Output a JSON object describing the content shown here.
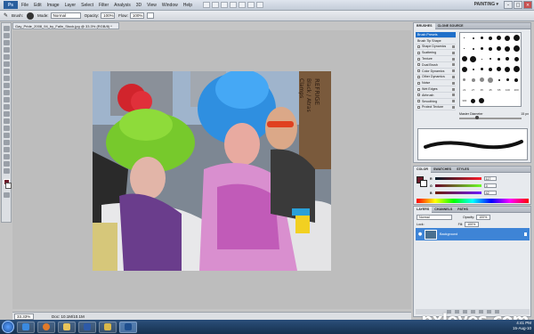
{
  "app": {
    "logo": "Ps",
    "menu": [
      "File",
      "Edit",
      "Image",
      "Layer",
      "Select",
      "Filter",
      "Analysis",
      "3D",
      "View",
      "Window",
      "Help"
    ],
    "workspace": "PAINTING ▾"
  },
  "options_bar": {
    "brush_label": "Brush:",
    "mode_label": "Mode:",
    "mode_value": "Normal",
    "opacity_label": "Opacity:",
    "opacity_value": "100%",
    "flow_label": "Flow:",
    "flow_value": "100%"
  },
  "document": {
    "tab_title": "Gay_Pride_2008_94_by_Falln_Stock.jpg @ 33.3% (RGB/8) *"
  },
  "status": {
    "zoom": "33.33%",
    "doc_info": "Doc: 10.1M/10.1M"
  },
  "brushes_panel": {
    "tabs": [
      "BRUSHES",
      "CLONE SOURCE"
    ],
    "sections": [
      "Brush Presets",
      "Brush Tip Shape",
      "Shape Dynamics",
      "Scattering",
      "Texture",
      "Dual Brush",
      "Color Dynamics",
      "Other Dynamics",
      "Noise",
      "Wet Edges",
      "Airbrush",
      "Smoothing",
      "Protect Texture"
    ],
    "selected_section": "Brush Presets",
    "preset_labels": [
      "21",
      "27",
      "35",
      "45",
      "65",
      "100",
      "200",
      "300"
    ],
    "master_diameter_label": "Master Diameter",
    "master_diameter_value": "15 px"
  },
  "color_panel": {
    "tabs": [
      "COLOR",
      "SWATCHES",
      "STYLES"
    ],
    "foreground_color": "#6c1a28",
    "background_color": "#ffffff",
    "r_label": "R",
    "r_value": "117",
    "g_label": "G",
    "g_value": "0",
    "b_label": "B",
    "b_value": "42"
  },
  "layers_panel": {
    "tabs": [
      "LAYERS",
      "CHANNELS",
      "PATHS"
    ],
    "blend_mode": "Normal",
    "opacity_label": "Opacity:",
    "opacity_value": "100%",
    "lock_label": "Lock:",
    "fill_label": "Fill:",
    "fill_value": "100%",
    "layer_name": "Background"
  },
  "taskbar": {
    "time": "4:41 PM",
    "date": "15-Aug-10"
  },
  "photo_signs": {
    "sign_text": "REFRIGE",
    "sign_text_2": "Black / Atras",
    "sign_text_3": "Clamps"
  },
  "watermark": "pxleyes.com"
}
